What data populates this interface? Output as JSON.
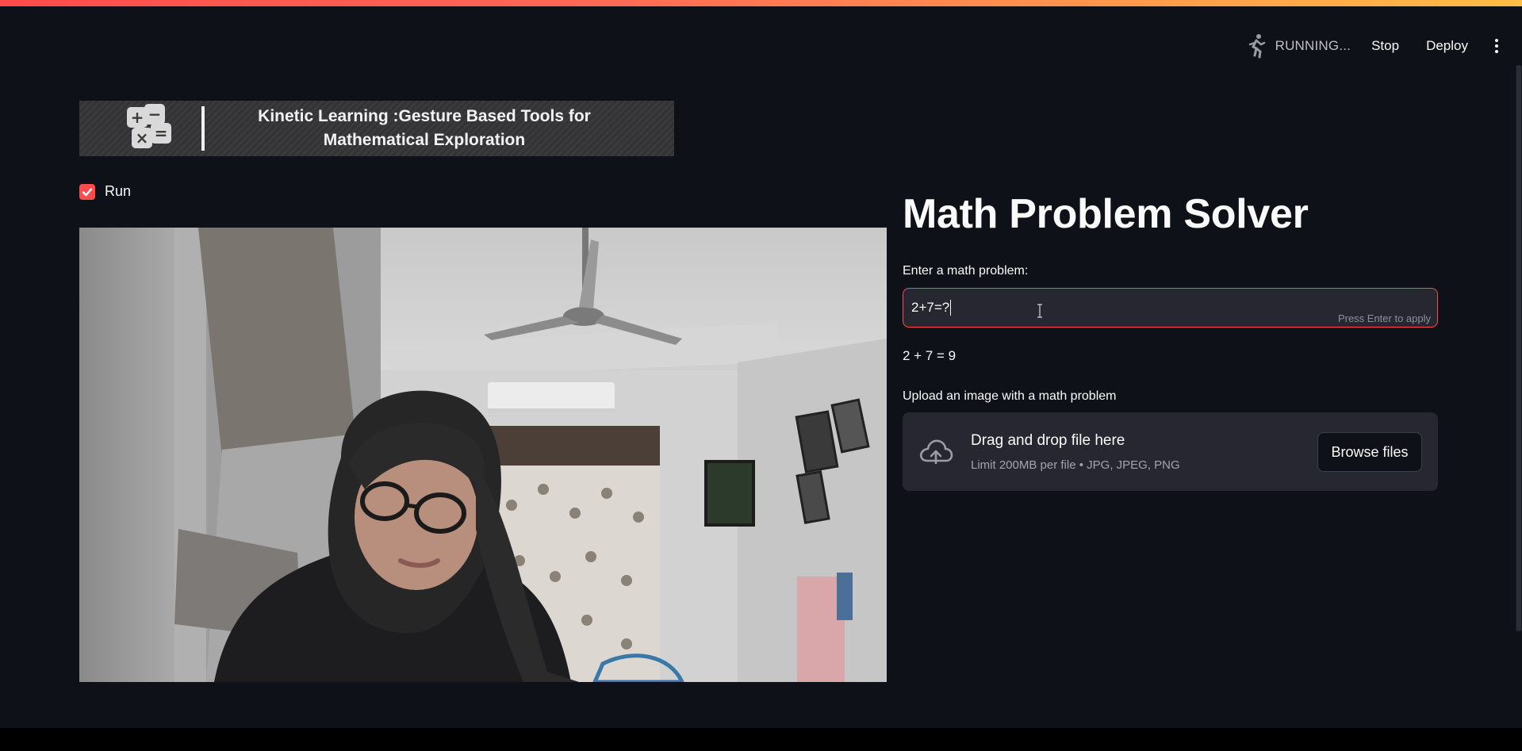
{
  "header": {
    "status_text": "RUNNING...",
    "stop_label": "Stop",
    "deploy_label": "Deploy",
    "menu_icon": "kebab-menu-icon",
    "status_icon": "running-man-icon"
  },
  "banner": {
    "title_line1": "Kinetic Learning :Gesture Based Tools for",
    "title_line2": "Mathematical Exploration",
    "logo_icon": "math-operators-icon",
    "symbols": [
      "+",
      "−",
      "×",
      "="
    ]
  },
  "run_checkbox": {
    "label": "Run",
    "checked": true
  },
  "camera": {
    "icon": "webcam-video-feed"
  },
  "main": {
    "title": "Math Problem Solver",
    "input_label": "Enter a math problem:",
    "input_value": "2+7=?",
    "input_hint": "Press Enter to apply",
    "result": "2 + 7 = 9",
    "upload_label": "Upload an image with a math problem",
    "dropzone_title": "Drag and drop file here",
    "dropzone_subtitle": "Limit 200MB per file • JPG, JPEG, PNG",
    "browse_label": "Browse files",
    "upload_icon": "cloud-upload-icon"
  },
  "colors": {
    "accent": "#ff4b4b",
    "background": "#0e1117",
    "widget_bg": "#262730"
  }
}
